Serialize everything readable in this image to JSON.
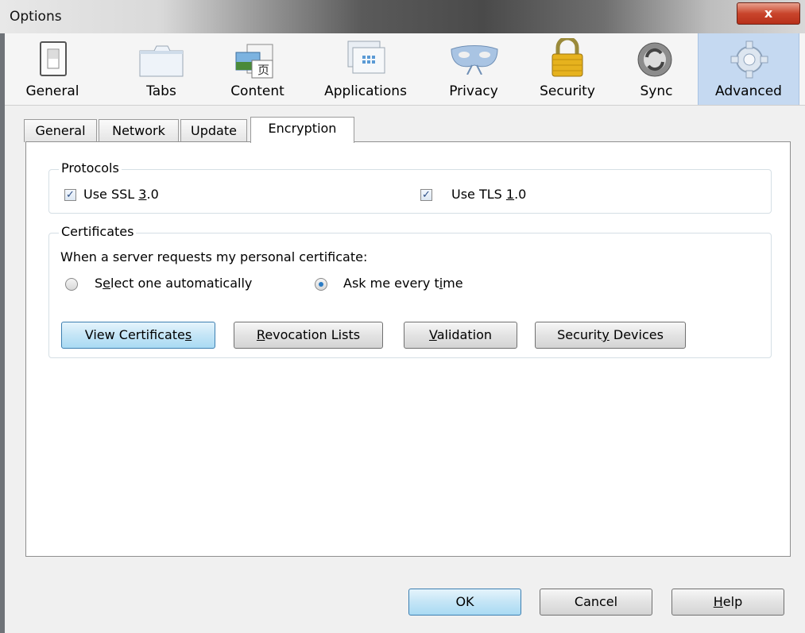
{
  "window": {
    "title": "Options",
    "close_glyph": "x"
  },
  "toolbar": {
    "panes": [
      {
        "label": "General",
        "icon": "switch-icon"
      },
      {
        "label": "Tabs",
        "icon": "tabs-icon"
      },
      {
        "label": "Content",
        "icon": "content-icon"
      },
      {
        "label": "Applications",
        "icon": "applications-icon"
      },
      {
        "label": "Privacy",
        "icon": "mask-icon"
      },
      {
        "label": "Security",
        "icon": "lock-icon"
      },
      {
        "label": "Sync",
        "icon": "sync-icon"
      },
      {
        "label": "Advanced",
        "icon": "gear-icon"
      }
    ],
    "selected": "Advanced"
  },
  "tabs": [
    "General",
    "Network",
    "Update",
    "Encryption"
  ],
  "active_tab": "Encryption",
  "protocols": {
    "title": "Protocols",
    "ssl": {
      "pre": "Use SSL ",
      "u": "3",
      "post": ".0",
      "checked": true
    },
    "tls": {
      "pre": "Use TLS ",
      "u": "1",
      "post": ".0",
      "checked": true
    }
  },
  "certificates": {
    "title": "Certificates",
    "prompt": "When a server requests my personal certificate:",
    "auto": {
      "pre": "S",
      "u": "e",
      "post": "lect one automatically",
      "selected": false
    },
    "ask": {
      "pre": "Ask me every t",
      "u": "i",
      "post": "me",
      "selected": true
    },
    "buttons": {
      "view": {
        "pre": "View Certificate",
        "u": "s",
        "post": ""
      },
      "revocation": {
        "pre": "",
        "u": "R",
        "post": "evocation Lists"
      },
      "validation": {
        "pre": "",
        "u": "V",
        "post": "alidation"
      },
      "devices": {
        "pre": "Securit",
        "u": "y",
        "post": " Devices"
      }
    }
  },
  "footer": {
    "ok": "OK",
    "cancel": "Cancel",
    "help": {
      "pre": "",
      "u": "H",
      "post": "elp"
    }
  },
  "colors": {
    "selected_pane": "#c5d9f1",
    "checkmark": "#2d4f87",
    "radio_dot": "#2a7bc4"
  }
}
